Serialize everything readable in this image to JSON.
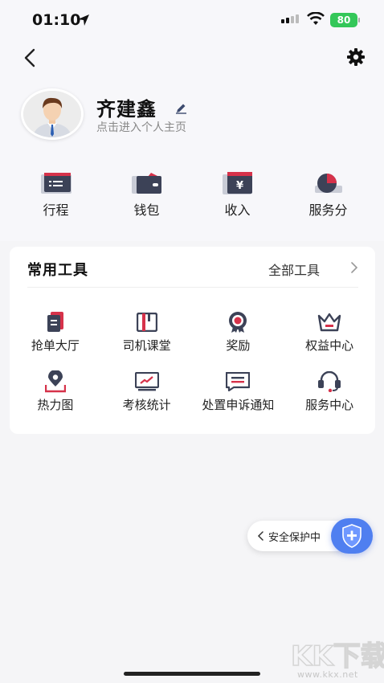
{
  "status_bar": {
    "time": "01:10",
    "battery": "80"
  },
  "profile": {
    "name": "齐建鑫",
    "subtitle": "点击进入个人主页"
  },
  "quick_actions": [
    {
      "label": "行程",
      "icon": "itinerary-icon"
    },
    {
      "label": "钱包",
      "icon": "wallet-icon"
    },
    {
      "label": "收入",
      "icon": "income-icon"
    },
    {
      "label": "服务分",
      "icon": "service-score-icon"
    }
  ],
  "tools": {
    "title": "常用工具",
    "all_label": "全部工具",
    "items": [
      {
        "label": "抢单大厅",
        "icon": "order-hall-icon"
      },
      {
        "label": "司机课堂",
        "icon": "driver-class-icon"
      },
      {
        "label": "奖励",
        "icon": "reward-icon"
      },
      {
        "label": "权益中心",
        "icon": "benefits-icon"
      },
      {
        "label": "热力图",
        "icon": "heatmap-icon"
      },
      {
        "label": "考核统计",
        "icon": "assessment-icon"
      },
      {
        "label": "处置申诉通知",
        "icon": "appeal-notice-icon"
      },
      {
        "label": "服务中心",
        "icon": "service-center-icon"
      }
    ]
  },
  "safety": {
    "label": "安全保护中"
  },
  "watermark": {
    "text": "KK下载",
    "url": "www.kkx.net"
  },
  "colors": {
    "accent_red": "#d6324a",
    "icon_navy": "#3c4257",
    "safety_blue": "#4f7ff0"
  }
}
